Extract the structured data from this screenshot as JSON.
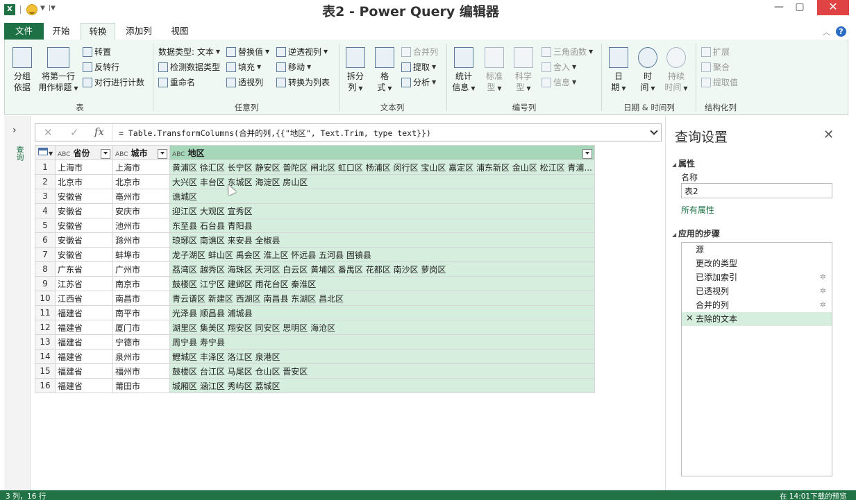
{
  "window": {
    "title": "表2 - Power Query 编辑器",
    "excel_icon": "X",
    "minimize": "—",
    "maximize": "▢",
    "close": "✕"
  },
  "ribbon_tabs": [
    "文件",
    "开始",
    "转换",
    "添加列",
    "视图"
  ],
  "active_tab": "转换",
  "ribbon": {
    "group_table": {
      "label": "表",
      "group_by": [
        "分组",
        "依据"
      ],
      "use_first_row": [
        "将第一行",
        "用作标题"
      ],
      "transpose": "转置",
      "reverse_rows": "反转行",
      "count_rows": "对行进行计数"
    },
    "group_any_column": {
      "label": "任意列",
      "data_type": "数据类型: 文本",
      "detect_type": "检测数据类型",
      "rename": "重命名",
      "replace_values": "替换值",
      "fill": "填充",
      "pivot": "透视列",
      "unpivot": "逆透视列",
      "move": "移动",
      "to_list": "转换为列表"
    },
    "group_text_column": {
      "label": "文本列",
      "split": [
        "拆分",
        "列"
      ],
      "format": [
        "格",
        "式"
      ],
      "merge": "合并列",
      "extract": "提取",
      "parse": "分析"
    },
    "group_number_column": {
      "label": "编号列",
      "statistics": [
        "统计",
        "信息"
      ],
      "standard": [
        "标准",
        "型"
      ],
      "scientific": [
        "科学",
        "型"
      ],
      "trig": "三角函数",
      "rounding": "舍入",
      "information": "信息"
    },
    "group_datetime": {
      "label": "日期 & 时间列",
      "date": [
        "日",
        "期"
      ],
      "time": [
        "时",
        "间"
      ],
      "duration": [
        "持续",
        "时间"
      ]
    },
    "group_structured": {
      "label": "结构化列",
      "expand": "扩展",
      "aggregate": "聚合",
      "extract_values": "提取值"
    }
  },
  "left_nav": {
    "label": "查询"
  },
  "formula_bar": {
    "cancel": "✕",
    "confirm": "✓",
    "fx": "fx",
    "formula": "= Table.TransformColumns(合并的列,{{\"地区\", Text.Trim, type text}})"
  },
  "grid": {
    "columns": [
      {
        "name": "省份",
        "type_icon": "ABC"
      },
      {
        "name": "城市",
        "type_icon": "ABC"
      },
      {
        "name": "地区",
        "type_icon": "ABC"
      }
    ],
    "rows": [
      [
        "1",
        "上海市",
        "上海市",
        "黄浦区 徐汇区 长宁区 静安区 普陀区 闸北区 虹口区 杨浦区 闵行区 宝山区 嘉定区 浦东新区 金山区 松江区 青浦..."
      ],
      [
        "2",
        "北京市",
        "北京市",
        "大兴区 丰台区 东城区 海淀区 房山区"
      ],
      [
        "3",
        "安徽省",
        "亳州市",
        "谯城区"
      ],
      [
        "4",
        "安徽省",
        "安庆市",
        "迎江区 大观区 宜秀区"
      ],
      [
        "5",
        "安徽省",
        "池州市",
        "东至县 石台县 青阳县"
      ],
      [
        "6",
        "安徽省",
        "滁州市",
        "琅琊区 南谯区 来安县 全椒县"
      ],
      [
        "7",
        "安徽省",
        "蚌埠市",
        "龙子湖区 蚌山区 禹会区 淮上区 怀远县 五河县 固镇县"
      ],
      [
        "8",
        "广东省",
        "广州市",
        "荔湾区 越秀区 海珠区 天河区 白云区 黄埔区 番禺区 花都区 南沙区 萝岗区"
      ],
      [
        "9",
        "江苏省",
        "南京市",
        "鼓楼区 江宁区 建邺区 雨花台区 秦淮区"
      ],
      [
        "10",
        "江西省",
        "南昌市",
        "青云谱区 新建区 西湖区 南昌县 东湖区 昌北区"
      ],
      [
        "11",
        "福建省",
        "南平市",
        "光泽县 顺昌县 浦城县"
      ],
      [
        "12",
        "福建省",
        "厦门市",
        "湖里区 集美区 翔安区 同安区 思明区 海沧区"
      ],
      [
        "13",
        "福建省",
        "宁德市",
        "周宁县 寿宁县"
      ],
      [
        "14",
        "福建省",
        "泉州市",
        "鲤城区 丰泽区 洛江区 泉港区"
      ],
      [
        "15",
        "福建省",
        "福州市",
        "鼓楼区 台江区 马尾区 仓山区 晋安区"
      ],
      [
        "16",
        "福建省",
        "莆田市",
        "城厢区 涵江区 秀屿区 荔城区"
      ]
    ]
  },
  "query_settings": {
    "title": "查询设置",
    "properties_header": "属性",
    "name_label": "名称",
    "name_value": "表2",
    "all_properties": "所有属性",
    "applied_steps_header": "应用的步骤",
    "steps": [
      "源",
      "更改的类型",
      "已添加索引",
      "已透视列",
      "合并的列",
      "去除的文本"
    ],
    "active_step": "去除的文本"
  },
  "status_bar": {
    "columns": "3 列，16 行",
    "preview": "在 14:01下载的预览"
  },
  "colors": {
    "accent_green": "#1e7145",
    "selected_column": "#d6eede",
    "close_red": "#e04343"
  }
}
